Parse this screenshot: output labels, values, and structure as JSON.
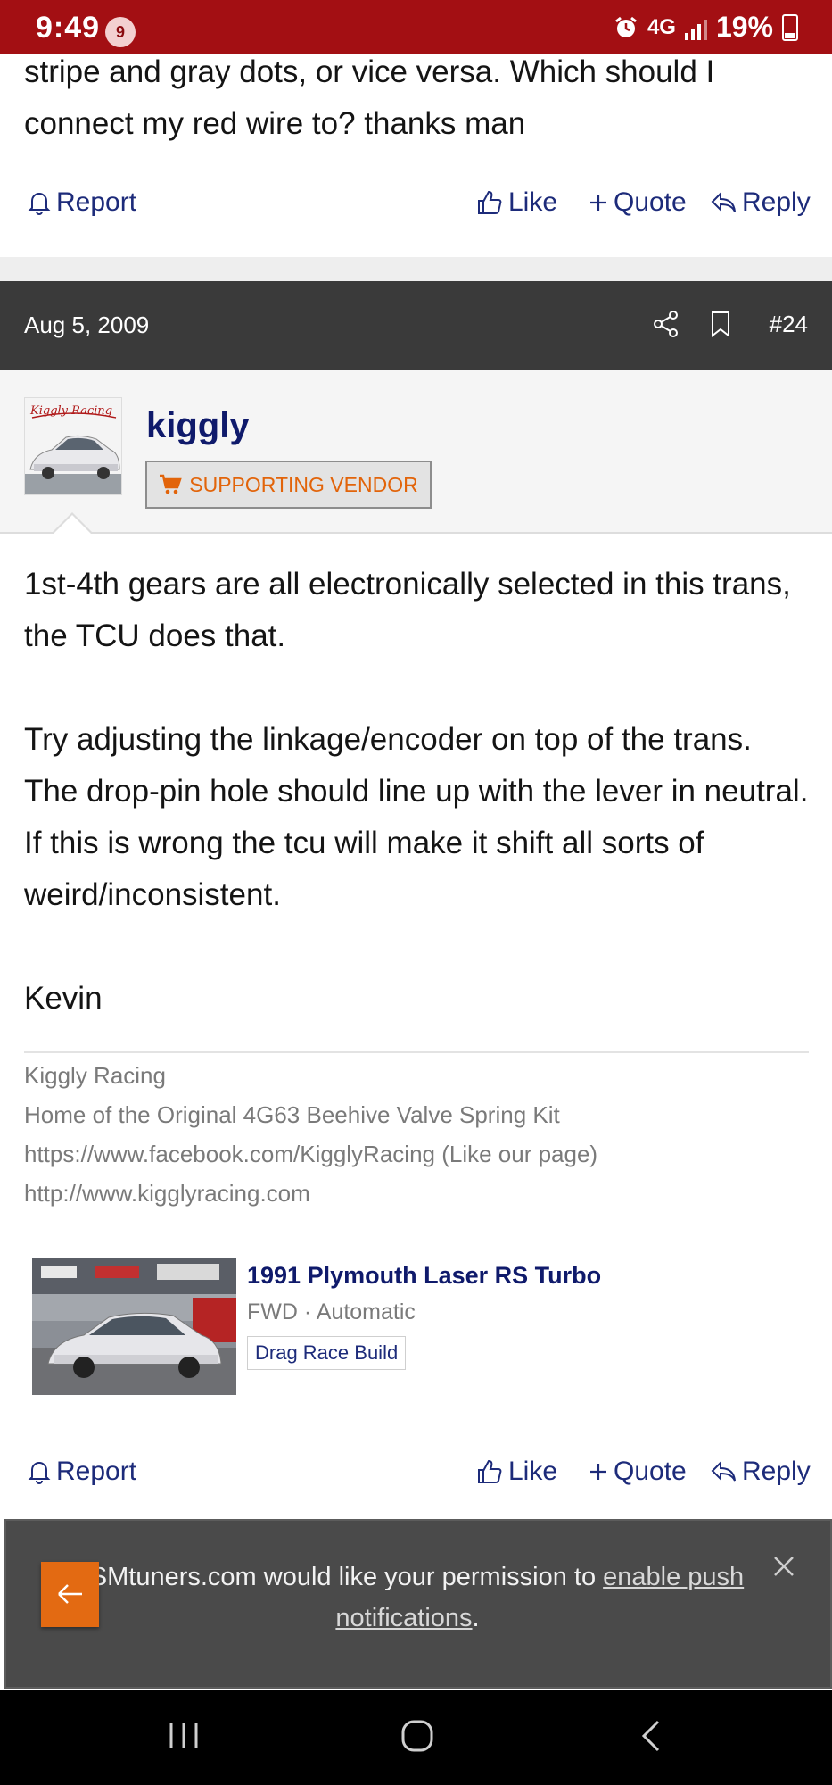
{
  "status_bar": {
    "time": "9:49",
    "notification_count": "9",
    "network": "4G",
    "battery": "19%"
  },
  "previous_post": {
    "text": "stripe and gray dots, or vice versa. Which should I connect my red wire to? thanks man",
    "actions": {
      "report": "Report",
      "like": "Like",
      "quote": "Quote",
      "reply": "Reply"
    }
  },
  "post": {
    "date": "Aug 5, 2009",
    "number": "#24",
    "author": {
      "username": "kiggly",
      "badge": "SUPPORTING VENDOR",
      "avatar_logo_text": "Kiggly Racing"
    },
    "body": {
      "paragraph1": "1st-4th gears are all electronically selected in this trans, the TCU does that.",
      "paragraph2": "Try adjusting the linkage/encoder on top of the trans. The drop-pin hole should line up with the lever in neutral. If this is wrong the tcu will make it shift all sorts of weird/inconsistent.",
      "signoff": "Kevin"
    },
    "signature": [
      "Kiggly Racing",
      "Home of the Original 4G63 Beehive Valve Spring Kit",
      "https://www.facebook.com/KigglyRacing (Like our page)",
      "http://www.kigglyracing.com"
    ],
    "car": {
      "title": "1991 Plymouth Laser RS Turbo",
      "subtitle": "FWD · Automatic",
      "tag": "Drag Race Build"
    },
    "actions": {
      "report": "Report",
      "like": "Like",
      "quote": "Quote",
      "reply": "Reply"
    }
  },
  "push_banner": {
    "text_before": "DSMtuners.com would like your permission to ",
    "link_text": "enable push notifications",
    "text_after": "."
  },
  "colors": {
    "status_bar": "#a30f13",
    "link_blue": "#1d2b7a",
    "username_blue": "#0f1a6b",
    "vendor_orange": "#e2640a",
    "header_dark": "#3a3a3a"
  }
}
